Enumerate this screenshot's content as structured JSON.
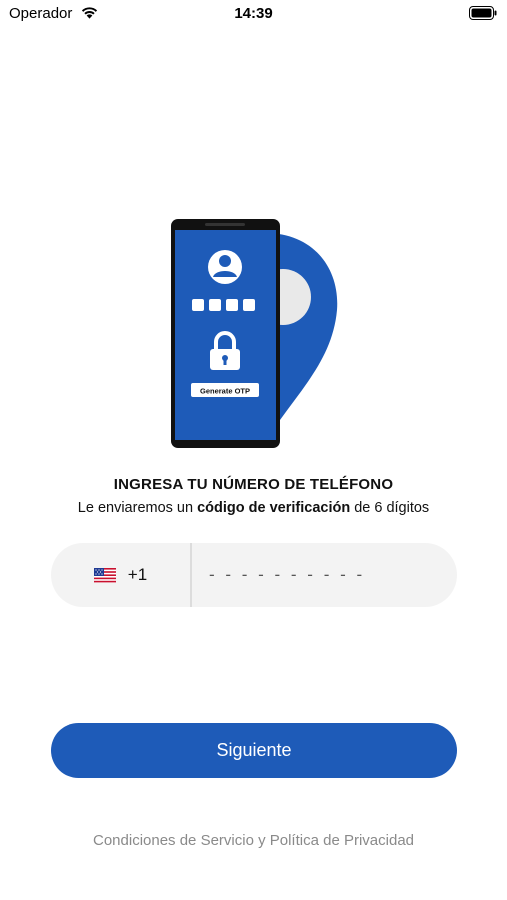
{
  "status_bar": {
    "carrier": "Operador",
    "time": "14:39"
  },
  "illustration": {
    "otp_button_label": "Generate OTP",
    "colors": {
      "brand_blue": "#1e5bb8",
      "phone_frame": "#111111"
    }
  },
  "header": {
    "title": "INGRESA TU NÚMERO DE TELÉFONO",
    "subtitle_prefix": "Le enviaremos un ",
    "subtitle_bold": "código de verificación",
    "subtitle_suffix": " de 6 dígitos"
  },
  "phone_input": {
    "country_flag": "us-flag-icon",
    "dial_code": "+1",
    "placeholder": "- - - - - - - - - -",
    "value": ""
  },
  "actions": {
    "next_label": "Siguiente"
  },
  "footer": {
    "terms_label": "Condiciones de Servicio y Política de Privacidad"
  },
  "colors": {
    "primary": "#1e5bb8",
    "input_background": "#f3f3f3",
    "muted_text": "#8a8a8a"
  }
}
